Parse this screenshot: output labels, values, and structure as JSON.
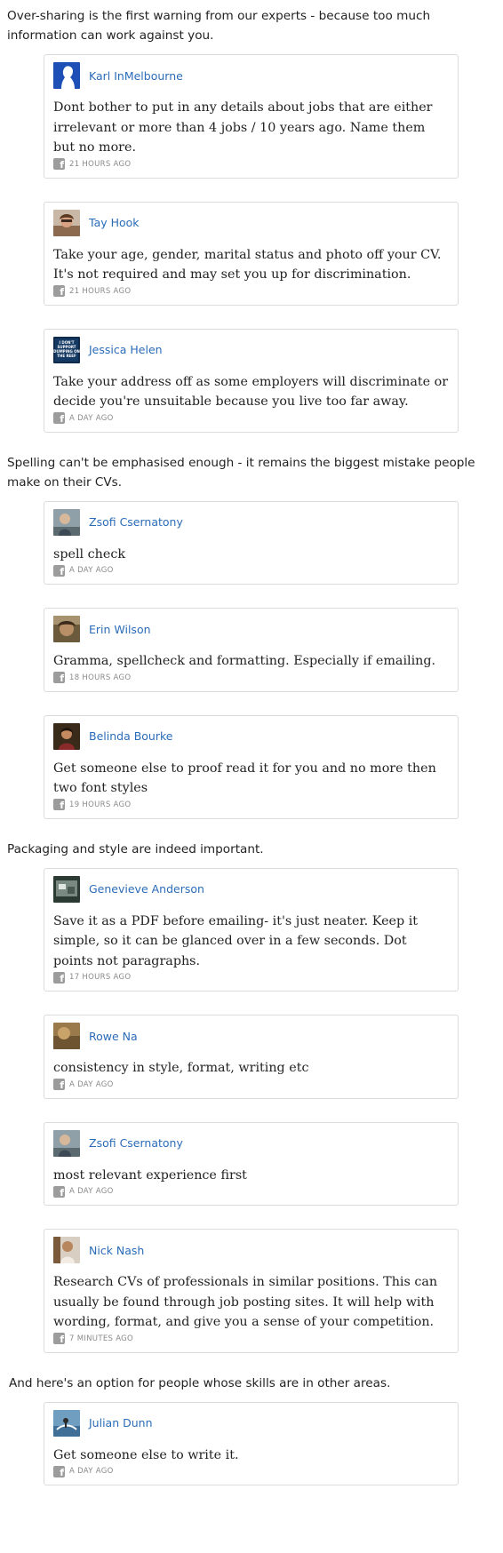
{
  "sections": [
    {
      "intro": "Over-sharing is the first warning from our experts - because too much information can work against you.",
      "comments": [
        {
          "author": "Karl InMelbourne",
          "text": "Dont bother to put in any details about jobs that are either irrelevant or more than 4 jobs / 10 years ago. Name them but no more.",
          "time": "21 HOURS AGO",
          "source_icon": "facebook-icon"
        },
        {
          "author": "Tay Hook",
          "text": "Take your age, gender, marital status and photo off your CV. It's not required and may set you up for discrimination.",
          "time": "21 HOURS AGO",
          "source_icon": "facebook-icon"
        },
        {
          "author": "Jessica Helen",
          "text": "Take your address off as some employers will discriminate or decide you're unsuitable because you live too far away.",
          "time": "A DAY AGO",
          "source_icon": "facebook-icon",
          "avatar_text": "I DON'T SUPPORT DUMPING ON THE REEF"
        }
      ]
    },
    {
      "intro": "Spelling can't be emphasised enough - it remains the biggest mistake people make on their CVs.",
      "comments": [
        {
          "author": "Zsofi Csernatony",
          "text": "spell check",
          "time": "A DAY AGO",
          "source_icon": "facebook-icon"
        },
        {
          "author": "Erin Wilson",
          "text": "Gramma, spellcheck and formatting. Especially if emailing.",
          "time": "18 HOURS AGO",
          "source_icon": "facebook-icon"
        },
        {
          "author": "Belinda Bourke",
          "text": "Get someone else to proof read it for you and no more then two font styles",
          "time": "19 HOURS AGO",
          "source_icon": "facebook-icon"
        }
      ]
    },
    {
      "intro": "Packaging and style are indeed important.",
      "comments": [
        {
          "author": "Genevieve Anderson",
          "text": "Save it as a PDF before emailing- it's just neater. Keep it simple, so it can be glanced over in a few seconds. Dot points not paragraphs.",
          "time": "17 HOURS AGO",
          "source_icon": "facebook-icon"
        },
        {
          "author": "Rowe Na",
          "text": "consistency in style, format, writing etc",
          "time": "A DAY AGO",
          "source_icon": "facebook-icon"
        },
        {
          "author": "Zsofi Csernatony",
          "text": "most relevant experience first",
          "time": "A DAY AGO",
          "source_icon": "facebook-icon"
        },
        {
          "author": "Nick Nash",
          "text": "Research CVs of professionals in similar positions. This can usually be found through job posting sites. It will help with wording, format, and give you a sense of your competition.",
          "time": "7 MINUTES AGO",
          "source_icon": "facebook-icon"
        }
      ]
    },
    {
      "intro": "And here's an option for people whose skills are in other areas.",
      "comments": [
        {
          "author": "Julian Dunn",
          "text": "Get someone else to write it.",
          "time": "A DAY AGO",
          "source_icon": "facebook-icon"
        }
      ]
    }
  ],
  "colors": {
    "author_link": "#2b6cb8",
    "card_border": "#dcdcdc",
    "meta_text": "#8a8a8a",
    "body_text": "#222222"
  }
}
